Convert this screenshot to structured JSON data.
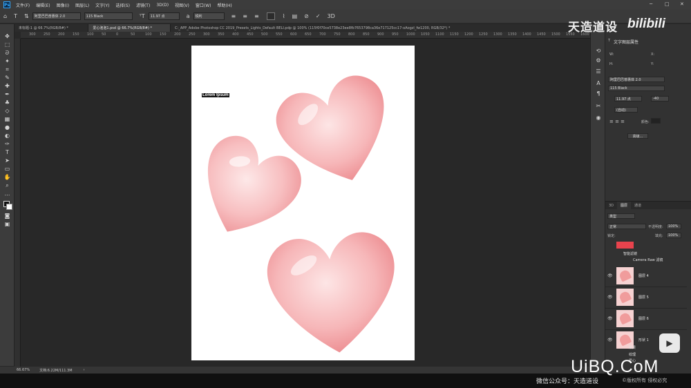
{
  "menu": {
    "app_icon": "Ps",
    "items": [
      "文件(F)",
      "编辑(E)",
      "图像(I)",
      "图层(L)",
      "文字(Y)",
      "选择(S)",
      "滤镜(T)",
      "3D(D)",
      "视图(V)",
      "窗口(W)",
      "帮助(H)"
    ],
    "minimize": "─",
    "maximize": "□",
    "close": "✕"
  },
  "options": {
    "font_family": "阿里巴巴普惠体 2.0",
    "font_style": "115 Black",
    "font_size": "11.97 点",
    "aa_label": "a",
    "aa_mode": "锐利",
    "cancel_glyph": "⃠",
    "commit_glyph": "✓",
    "threed_label": "3D"
  },
  "tabs": [
    {
      "label": "未标题-1 @ 66.7%(RGB/8#) *",
      "active": false
    },
    {
      "label": "爱心泡泡1.psd @ 66.7%(RGB/8#) *",
      "active": true
    },
    {
      "label": "C:_APP_Adobe Photoshop CC 2019_Presets_Lights_Default BELI.pdp @ 100% (115f0f70ce5738e23ee8fb7653798ca36e717125cc17-oAogzl_fw1200, RGB/32*) *",
      "active": false
    }
  ],
  "ruler_ticks": [
    "300",
    "250",
    "200",
    "150",
    "100",
    "50",
    "0",
    "50",
    "100",
    "150",
    "200",
    "250",
    "300",
    "350",
    "400",
    "450",
    "500",
    "550",
    "600",
    "650",
    "700",
    "750",
    "800",
    "850",
    "900",
    "950",
    "1000",
    "1050",
    "1100",
    "1150",
    "1200",
    "1250",
    "1300",
    "1350",
    "1400",
    "1450",
    "1500",
    "1550",
    "1600",
    "1650"
  ],
  "canvas": {
    "text_layer": "Lorem Ipsum"
  },
  "status": {
    "zoom": "66.67%",
    "doc_size": "文档:6.22M/111.3M",
    "arrow": "›"
  },
  "properties": {
    "title": "文字图层属性",
    "font_family": "阿里巴巴普惠体 2.0",
    "font_style": "115 Black",
    "font_size": "11.97 点",
    "tracking": "-40",
    "leading": "(自动)",
    "color_label": "颜色:",
    "advanced_button": "高级...",
    "w_label": "W:",
    "x_label": "X:",
    "h_label": "H:",
    "y_label": "Y:"
  },
  "layers_panel": {
    "tabs": [
      "3D",
      "图层",
      "通道"
    ],
    "blend_mode": "正常",
    "opacity_label": "不透明度:",
    "opacity_value": "100%",
    "fill_label": "填充:",
    "fill_value": "100%",
    "lock_label": "锁定:",
    "search_placeholder": "类型",
    "smart_filter": "智能滤镜",
    "camera_raw": "Camera Raw 滤镜",
    "layers": [
      "图层 4",
      "图层 5",
      "图层 6",
      "形状 1"
    ],
    "sub_fx": "效果",
    "sub_texture": "纹理",
    "sub_love": "爱心"
  },
  "watermarks": {
    "top_cn": "天造道设",
    "top_bili": "bilibili",
    "uibq": "UiBQ.CoM",
    "bottom_cn": "微信公众号：天造道设",
    "copyright": "©版权所有 侵权必究"
  },
  "colors": {
    "heart_main": "#f4a7a9",
    "heart_dark": "#e8777c",
    "accent": "#31a8ff"
  }
}
